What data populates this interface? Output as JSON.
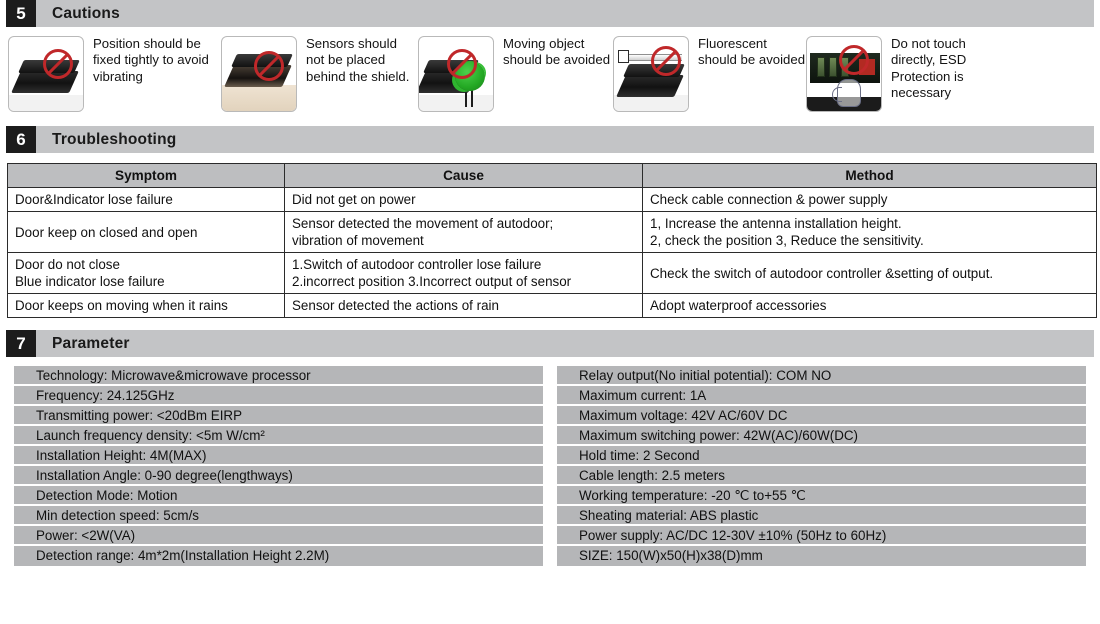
{
  "sections": {
    "cautions": {
      "number": "5",
      "title": "Cautions"
    },
    "troubleshooting": {
      "number": "6",
      "title": "Troubleshooting"
    },
    "parameter": {
      "number": "7",
      "title": "Parameter"
    }
  },
  "cautions": {
    "items": [
      {
        "icon": "no-entry-sign-icon",
        "image": "sensor-device-thumbnail",
        "text": "Position should be fixed tightly to avoid vibrating"
      },
      {
        "icon": "no-entry-sign-icon",
        "image": "sensor-behind-shield-thumbnail",
        "text": "Sensors should not be placed behind the shield."
      },
      {
        "icon": "no-entry-sign-icon",
        "image": "sensor-with-tree-thumbnail",
        "text": "Moving object should be avoided"
      },
      {
        "icon": "no-entry-sign-icon",
        "image": "sensor-with-fluorescent-lamp-thumbnail",
        "text": "Fluorescent should be avoided"
      },
      {
        "icon": "no-entry-sign-icon",
        "image": "sensor-pcb-hand-touch-thumbnail",
        "text": "Do not touch directly, ESD Protection is necessary"
      }
    ]
  },
  "troubleshooting": {
    "headers": [
      "Symptom",
      "Cause",
      "Method"
    ],
    "rows": [
      {
        "symptom": "Door&Indicator lose failure",
        "symptom2": "",
        "cause": "Did not get on power",
        "cause2": "",
        "method": "Check cable connection & power supply",
        "method2": ""
      },
      {
        "symptom": "Door keep on closed and open",
        "symptom2": "",
        "cause": "Sensor detected the movement of autodoor;",
        "cause2": "vibration of movement",
        "method": "1, Increase the antenna installation height.",
        "method2": "2, check the position  3, Reduce the sensitivity."
      },
      {
        "symptom": "Door do not close",
        "symptom2": "Blue indicator lose failure",
        "cause": "1.Switch of autodoor controller lose failure",
        "cause2": "2.incorrect position 3.Incorrect output of sensor",
        "method": "Check the switch of autodoor controller &setting of output.",
        "method2": ""
      },
      {
        "symptom": "Door keeps on moving when it rains",
        "symptom2": "",
        "cause": "Sensor detected the actions of rain",
        "cause2": "",
        "method": "Adopt waterproof accessories",
        "method2": ""
      }
    ]
  },
  "parameter": {
    "left": [
      "Technology: Microwave&microwave processor",
      "Frequency: 24.125GHz",
      "Transmitting power: <20dBm EIRP",
      "Launch frequency density: <5m W/cm²",
      "Installation Height: 4M(MAX)",
      "Installation Angle: 0-90 degree(lengthways)",
      "Detection Mode:  Motion",
      "Min detection speed: 5cm/s",
      "Power: <2W(VA)",
      "Detection range: 4m*2m(Installation Height 2.2M)"
    ],
    "right": [
      "Relay output(No initial potential): COM  NO",
      "Maximum current: 1A",
      "Maximum voltage: 42V AC/60V DC",
      "Maximum switching power: 42W(AC)/60W(DC)",
      "Hold time: 2 Second",
      "Cable length: 2.5 meters",
      "Working temperature: -20 ℃ to+55 ℃",
      "Sheating material: ABS plastic",
      "Power supply: AC/DC 12-30V ±10% (50Hz to 60Hz)",
      "SIZE: 150(W)x50(H)x38(D)mm"
    ]
  },
  "colors": {
    "header_bar": "#c3c4c6",
    "header_badge": "#1c1c1c",
    "table_header": "#bdbec0",
    "param_row": "#b5b6b8",
    "border": "#2b2b2b",
    "warning_red": "#c0282a"
  }
}
